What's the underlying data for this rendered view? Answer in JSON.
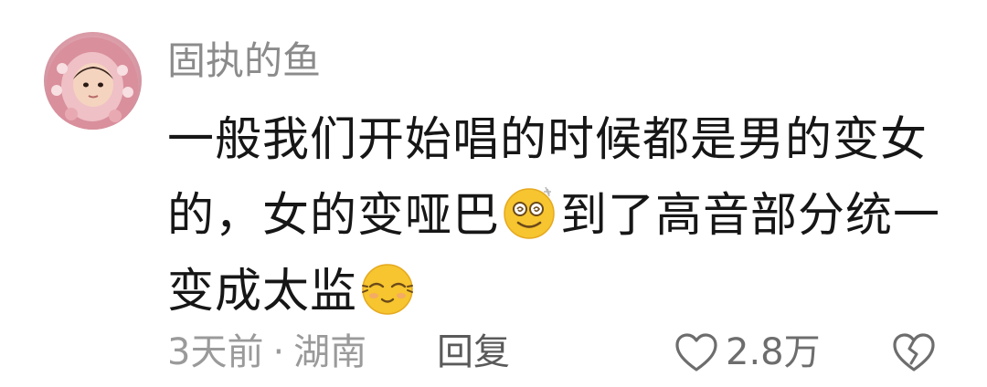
{
  "comment": {
    "username": "固执的鱼",
    "content": {
      "segment_1": "一般我们开始唱的时候都是男的变女的，女的变哑巴",
      "emoji_1": "dizzy-smile-emoji",
      "segment_2": "到了高音部分统一变成太监",
      "emoji_2": "shy-smile-emoji"
    },
    "time": "3天前",
    "separator": "·",
    "location": "湖南",
    "reply_label": "回复",
    "like_count": "2.8万",
    "icons": {
      "like": "heart-outline-icon",
      "dislike": "broken-heart-icon"
    }
  },
  "colors": {
    "username": "#8b8b8b",
    "content": "#161616",
    "meta": "#9a9a9a",
    "reply": "#5a5a5a",
    "emoji_face": "#f6c52f"
  }
}
